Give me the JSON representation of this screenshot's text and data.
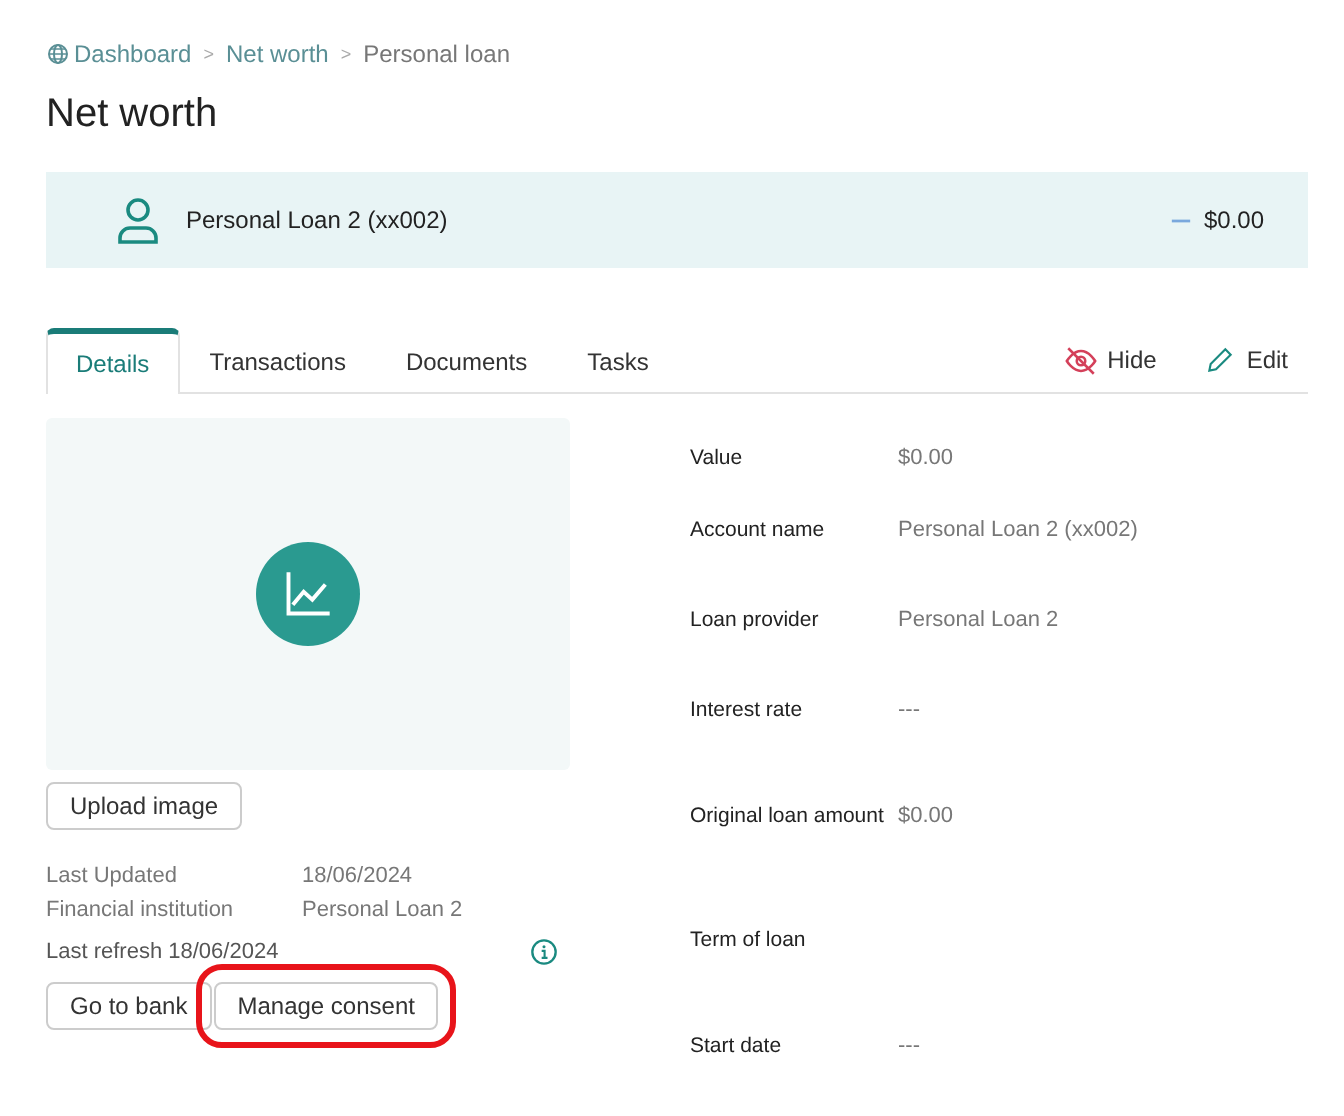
{
  "breadcrumb": {
    "separator": ">",
    "items": [
      {
        "label": "Dashboard",
        "kind": "home"
      },
      {
        "label": "Net worth",
        "kind": "link"
      },
      {
        "label": "Personal loan",
        "kind": "current"
      }
    ]
  },
  "title": "Net worth",
  "account": {
    "name": "Personal Loan 2 (xx002)",
    "balance": "$0.00"
  },
  "tabs": [
    {
      "label": "Details",
      "selected": true
    },
    {
      "label": "Transactions",
      "selected": false
    },
    {
      "label": "Documents",
      "selected": false
    },
    {
      "label": "Tasks",
      "selected": false
    }
  ],
  "actions": [
    {
      "label": "Hide",
      "kind": "hide"
    },
    {
      "label": "Edit",
      "kind": "edit"
    }
  ],
  "upload_button": "Upload image",
  "info": [
    {
      "label": "Last Updated",
      "value": "18/06/2024"
    },
    {
      "label": "Financial institution",
      "value": "Personal Loan 2"
    }
  ],
  "last_refresh": "Last refresh 18/06/2024",
  "buttons": [
    {
      "label": "Go to bank",
      "highlighted": false
    },
    {
      "label": "Manage consent",
      "highlighted": true
    }
  ],
  "fields": [
    {
      "label": "Value",
      "value": "$0.00"
    },
    {
      "label": "Account name",
      "value": "Personal Loan 2 (xx002)"
    },
    {
      "label": "Loan provider",
      "value": "Personal Loan 2"
    },
    {
      "label": "Interest rate",
      "value": "---"
    },
    {
      "label": "Original loan amount",
      "value": "$0.00"
    },
    {
      "label": "Term of loan"
    },
    {
      "label": "Start date",
      "value": "---"
    }
  ]
}
